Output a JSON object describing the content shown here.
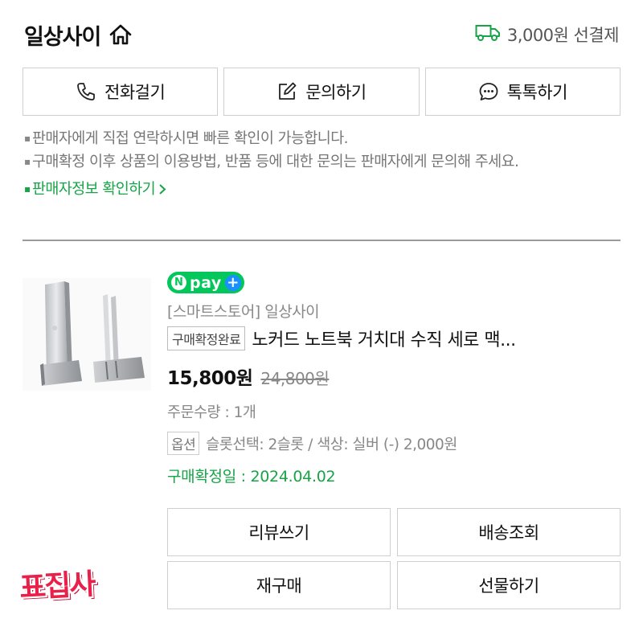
{
  "header": {
    "store_name": "일상사이",
    "shipping_text": "3,000원 선결제"
  },
  "contact_buttons": [
    {
      "label": "전화걸기",
      "icon": "phone-icon"
    },
    {
      "label": "문의하기",
      "icon": "edit-icon"
    },
    {
      "label": "톡톡하기",
      "icon": "chat-icon"
    }
  ],
  "notices": [
    "판매자에게 직접 연락하시면 빠른 확인이 가능합니다.",
    "구매확정 이후 상품의 이용방법, 반품 등에 대한 문의는 판매자에게 문의해 주세요."
  ],
  "seller_info_link": "판매자정보 확인하기",
  "product": {
    "badge": {
      "n": "N",
      "pay": "pay",
      "plus": "+"
    },
    "store_line": "[스마트스토어] 일상사이",
    "status_tag": "구매확정완료",
    "name": "노커드 노트북 거치대 수직 세로 맥...",
    "price": "15,800원",
    "original_price": "24,800원",
    "quantity": "주문수량 : 1개",
    "option_tag": "옵션",
    "option_text": "슬롯선택: 2슬롯 / 색상: 실버 (-) 2,000원",
    "confirm_date": "구매확정일 : 2024.04.02"
  },
  "actions": {
    "review": "리뷰쓰기",
    "tracking": "배송조회",
    "repurchase": "재구매",
    "gift": "선물하기"
  },
  "watermark": "표집사",
  "colors": {
    "accent_green": "#17a446",
    "npay_green": "#03c75a",
    "npay_plus_blue": "#1a8fff",
    "watermark_red": "#e8204a"
  }
}
